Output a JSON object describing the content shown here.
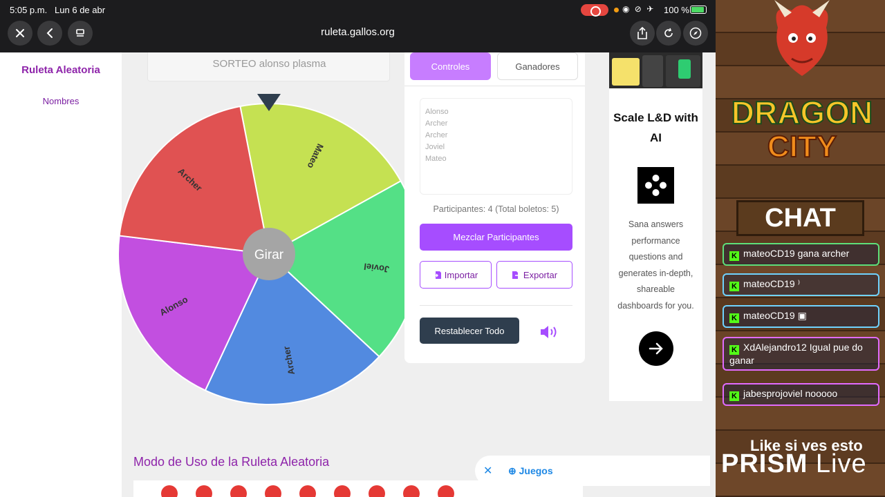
{
  "status_bar": {
    "time": "5:05 p.m.",
    "date": "Lun 6 de abr",
    "battery": "100 %"
  },
  "browser": {
    "url": "ruleta.gallos.org"
  },
  "sidebar": {
    "brand": "Ruleta Aleatoria",
    "links": [
      "Nombres"
    ]
  },
  "wheel": {
    "title": "SORTEO alonso plasma",
    "spin_label": "Girar",
    "segments": [
      {
        "label": "Mateo",
        "color": "#c5e152"
      },
      {
        "label": "Joviel",
        "color": "#54e086"
      },
      {
        "label": "Archer",
        "color": "#528ae0"
      },
      {
        "label": "Alonso",
        "color": "#c24fe0"
      },
      {
        "label": "Archer",
        "color": "#e05252"
      }
    ]
  },
  "controls": {
    "tabs": [
      "Controles",
      "Ganadores"
    ],
    "names": [
      "Alonso",
      "Archer",
      "Archer",
      "Joviel",
      "Mateo"
    ],
    "participants": "Participantes: 4 (Total boletos: 5)",
    "shuffle": "Mezclar Participantes",
    "import": "Importar",
    "export": "Exportar",
    "reset": "Restablecer Todo"
  },
  "ad": {
    "title": "Scale L&D with AI",
    "body": "Sana answers performance questions and generates in-depth, shareable dashboards for you."
  },
  "section": {
    "title": "Modo de Uso de la Ruleta Aleatoria"
  },
  "juegos": {
    "label": "Juegos"
  },
  "stream": {
    "logo_line1": "DRAGON",
    "logo_line2": "CITY",
    "chat_sign": "CHAT",
    "messages": [
      {
        "user": "mateoCD19",
        "text": "gana archer",
        "color": "#5ee07a"
      },
      {
        "user": "mateoCD19",
        "text": "⁾",
        "color": "#6fd3ff"
      },
      {
        "user": "mateoCD19",
        "text": "▣",
        "color": "#6fd3ff"
      },
      {
        "user": "XdAlejandro12",
        "text": "Igual pue do ganar",
        "color": "#e26bff"
      },
      {
        "user": "jabesprojoviel",
        "text": "nooooo",
        "color": "#e26bff"
      }
    ],
    "like_text": "Like si ves esto",
    "prism": "PRISM",
    "prism_live": "Live"
  },
  "colors": {
    "accent": "#a64dff",
    "brand": "#8e24aa"
  }
}
